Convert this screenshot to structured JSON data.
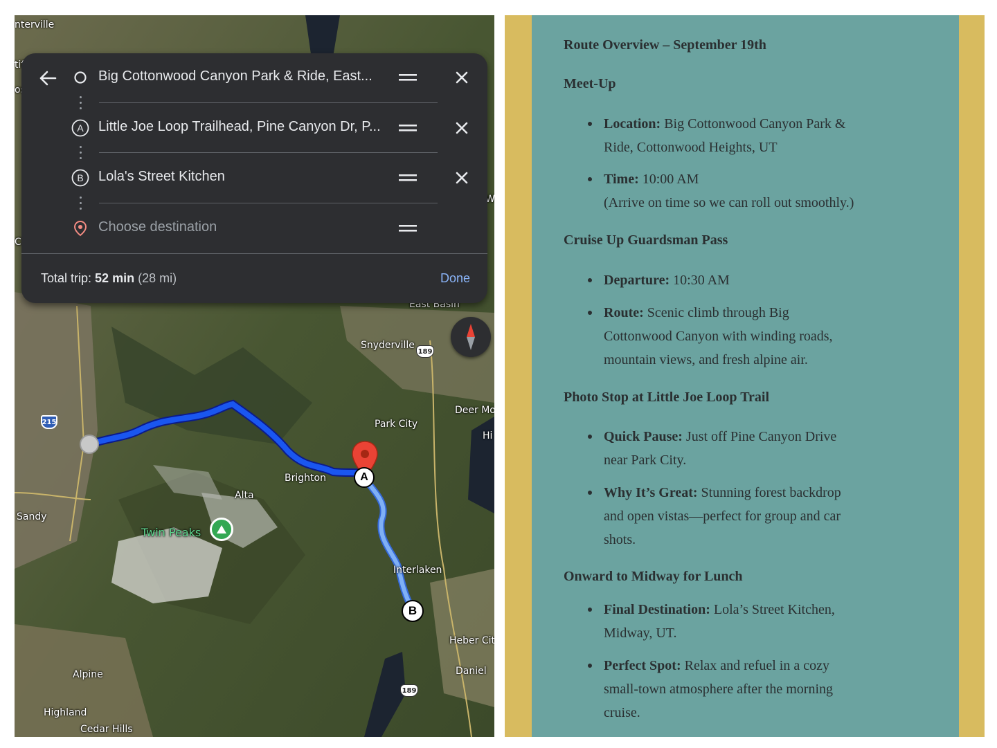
{
  "map": {
    "places": {
      "centerville": "nterville",
      "sandy": "Sandy",
      "brighton": "Brighton",
      "alta": "Alta",
      "twin_peaks": "Twin Peaks",
      "snyderville": "Snyderville",
      "park_city": "Park City",
      "deer_mountain": "Deer Mo",
      "hi": "Hi",
      "east_basin": "East Basin",
      "interlaken": "Interlaken",
      "heber_city": "Heber City",
      "daniel": "Daniel",
      "alpine": "Alpine",
      "highland": "Highland",
      "cedar_hills": "Cedar Hills",
      "edge_w": "W",
      "edge_ci": "Ci",
      "edge_ti": "tif",
      "edge_os": "os"
    },
    "shields": {
      "i215": "215",
      "us189_north": "189",
      "us189_south": "189"
    },
    "pins": {
      "a": "A",
      "b": "B"
    }
  },
  "directions": {
    "stops": [
      {
        "label": "Big Cottonwood Canyon Park & Ride, East...",
        "marker": "origin"
      },
      {
        "label": "Little Joe Loop Trailhead, Pine Canyon Dr, P...",
        "marker": "A"
      },
      {
        "label": "Lola's Street Kitchen",
        "marker": "B"
      }
    ],
    "destination_placeholder": "Choose destination",
    "total_label": "Total trip:",
    "total_time": "52 min",
    "total_distance": "(28 mi)",
    "done_label": "Done"
  },
  "itinerary": {
    "title": "Route Overview – September 19th",
    "sections": [
      {
        "heading": "Meet-Up",
        "items": [
          {
            "label": "Location:",
            "lines": [
              " Big Cottonwood Canyon Park &",
              "Ride, Cottonwood Heights, UT"
            ]
          },
          {
            "label": "Time:",
            "lines": [
              " 10:00 AM",
              "(Arrive on time so we can roll out smoothly.)"
            ]
          }
        ]
      },
      {
        "heading": "Cruise Up Guardsman Pass",
        "items": [
          {
            "label": "Departure:",
            "lines": [
              " 10:30 AM"
            ]
          },
          {
            "label": "Route:",
            "lines": [
              " Scenic climb through Big",
              "Cottonwood Canyon with winding roads,",
              "mountain views, and fresh alpine air."
            ]
          }
        ]
      },
      {
        "heading": "Photo Stop at Little Joe Loop Trail",
        "items": [
          {
            "label": "Quick Pause:",
            "lines": [
              " Just off Pine Canyon Drive",
              "near Park City."
            ]
          },
          {
            "label": "Why It’s Great:",
            "lines": [
              " Stunning forest backdrop",
              "and open vistas—perfect for group and car",
              "shots."
            ]
          }
        ]
      },
      {
        "heading": "Onward to Midway for Lunch",
        "items": [
          {
            "label": "Final Destination:",
            "lines": [
              " Lola’s Street Kitchen,",
              "Midway, UT."
            ]
          },
          {
            "label": "Perfect Spot:",
            "lines": [
              " Relax and refuel in a cozy",
              "small-town atmosphere after the morning",
              "cruise."
            ]
          }
        ]
      }
    ]
  },
  "colors": {
    "route_primary": "#1a56f0",
    "route_secondary": "#7fb0f5",
    "card_bg": "#2d2e31",
    "done_link": "#8ab4f8",
    "itinerary_border": "#d8bb5f",
    "itinerary_bg": "#6ba3a0",
    "pin_red": "#ea4335",
    "park_green": "#34a853"
  },
  "icons": [
    "back-arrow-icon",
    "origin-circle-icon",
    "drag-handle-icon",
    "close-icon",
    "destination-pin-icon",
    "compass-icon",
    "park-icon",
    "red-pin-icon"
  ]
}
